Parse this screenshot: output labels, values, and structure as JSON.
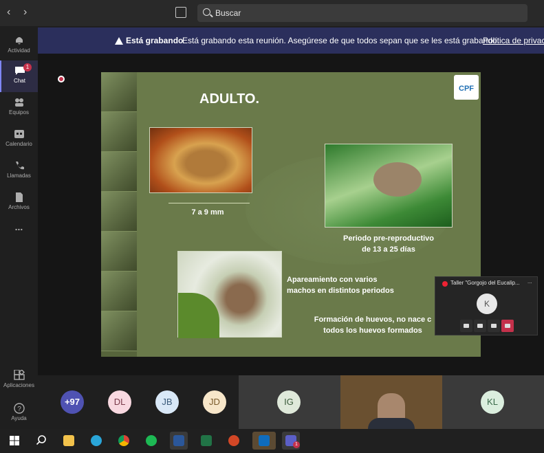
{
  "search": {
    "placeholder": "Buscar"
  },
  "rail": {
    "items": [
      {
        "label": "Actividad"
      },
      {
        "label": "Chat",
        "badge": "1"
      },
      {
        "label": "Equipos"
      },
      {
        "label": "Calendario"
      },
      {
        "label": "Llamadas"
      },
      {
        "label": "Archivos"
      },
      {
        "label": "..."
      }
    ],
    "apps_label": "Aplicaciones",
    "help_label": "Ayuda"
  },
  "banner": {
    "title": "Está grabando",
    "message": "Está grabando esta reunión. Asegúrese de que todos sepan que se les está grabando.",
    "link": "Política de privaci"
  },
  "slide": {
    "title": "ADULTO.",
    "logo": "CPF",
    "size_text": "7 a 9 mm",
    "prerepro_line1": "Periodo pre-reproductivo",
    "prerepro_line2": "de 13 a 25 días",
    "mating_line1": "Apareamiento con varios",
    "mating_line2": "machos en distintos periodos",
    "eggs_line1": "Formación de huevos, no nace c",
    "eggs_line2": "todos los huevos formados"
  },
  "popup": {
    "title": "Taller \"Gorgojo del Eucalip...",
    "more": "...",
    "avatar": "K"
  },
  "participants": [
    {
      "initials": "+97"
    },
    {
      "initials": "DL"
    },
    {
      "initials": "JB"
    },
    {
      "initials": "JD"
    },
    {
      "initials": "IG"
    },
    {
      "initials": "KL"
    }
  ],
  "taskbar": {
    "teams_badge": "1"
  }
}
